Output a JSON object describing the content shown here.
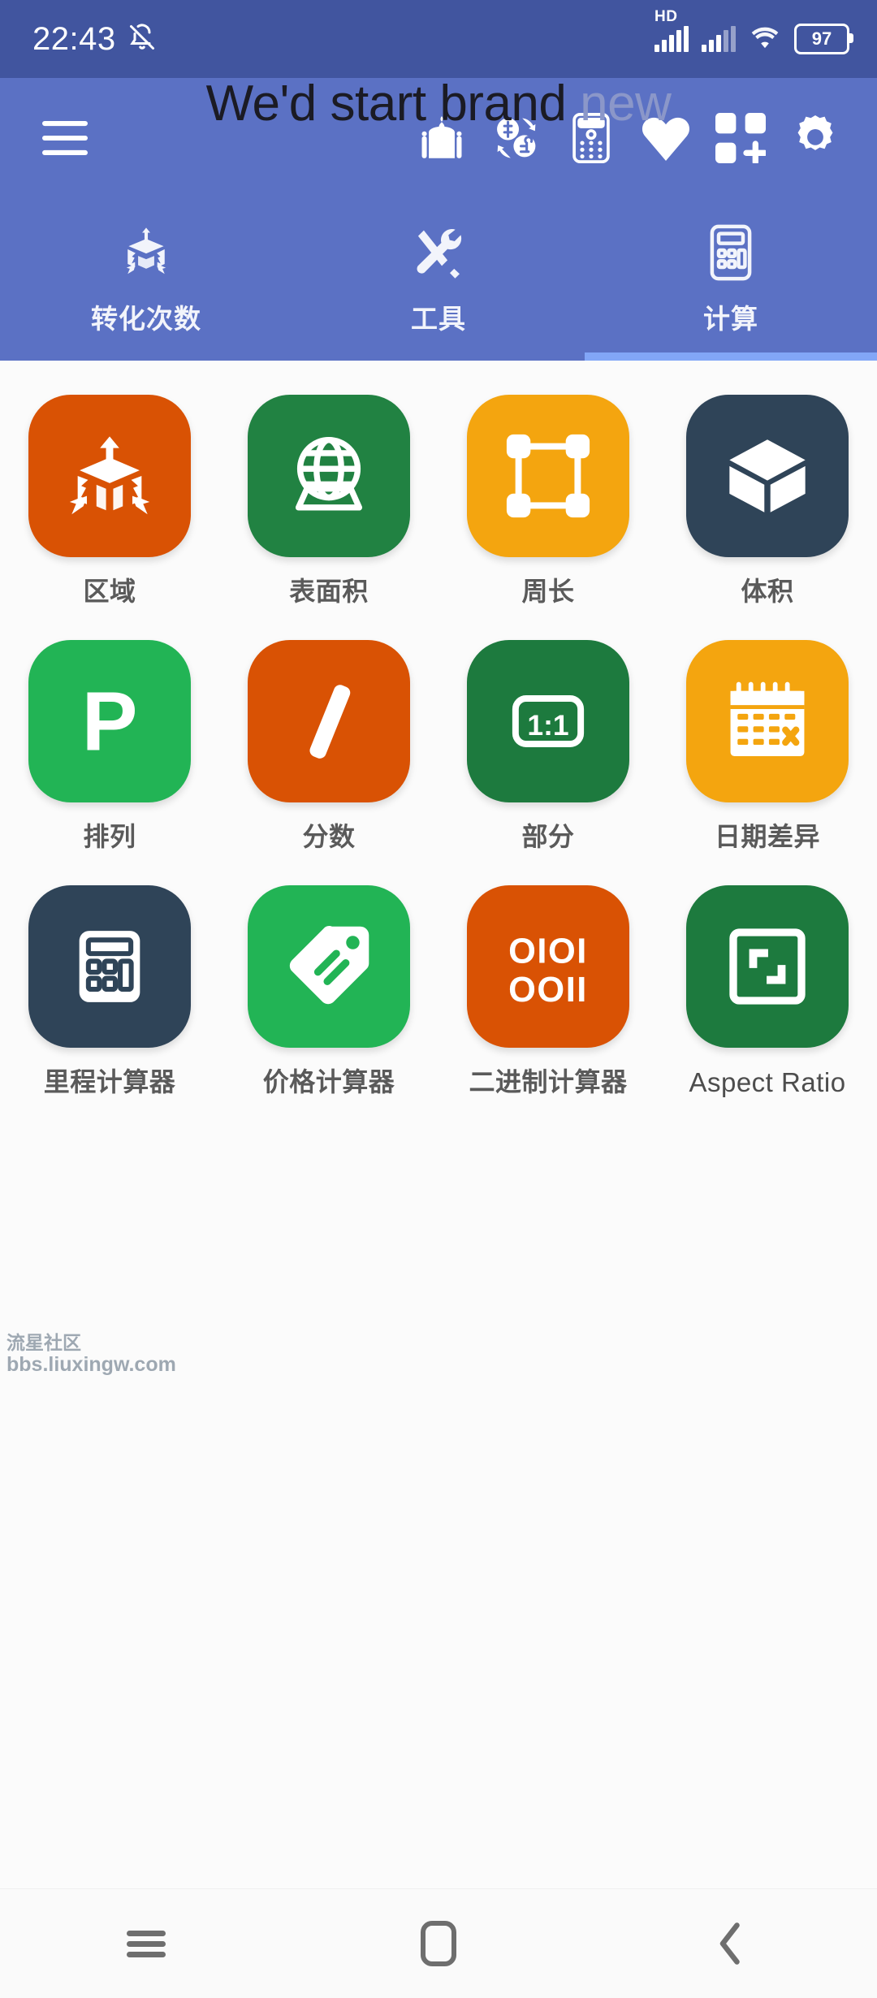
{
  "status_bar": {
    "time": "22:43",
    "notification_icon": "bell-muted-icon",
    "network_label": "HD",
    "signal_icon": "signal-bars-icon",
    "signal2_icon": "signal-bars-secondary-icon",
    "wifi_icon": "wifi-icon",
    "battery_level": "97",
    "background_color": "#41559f"
  },
  "app_bar": {
    "overlay_title_main": "We'd start brand",
    "overlay_title_faded": "new",
    "background_color": "#5b71c4",
    "icons": [
      {
        "name": "menu-icon",
        "label": "Menu"
      },
      {
        "name": "mosque-icon",
        "label": "Mosque"
      },
      {
        "name": "currency-exchange-icon",
        "label": "Currency"
      },
      {
        "name": "calculator-device-icon",
        "label": "Calculator"
      },
      {
        "name": "heart-icon",
        "label": "Favorites"
      },
      {
        "name": "add-widget-icon",
        "label": "Add widget"
      },
      {
        "name": "gear-icon",
        "label": "Settings"
      }
    ]
  },
  "tabs": [
    {
      "label": "转化次数",
      "icon": "convert-box-icon",
      "active": false
    },
    {
      "label": "工具",
      "icon": "tools-icon",
      "active": false
    },
    {
      "label": "计算",
      "icon": "calculator-icon",
      "active": true
    }
  ],
  "tab_indicator_color": "#82a6f7",
  "grid": {
    "items": [
      {
        "label": "区域",
        "icon": "area-box-arrows-icon",
        "color": "#d95204",
        "latin": false
      },
      {
        "label": "表面积",
        "icon": "surface-globe-icon",
        "color": "#218242",
        "latin": false
      },
      {
        "label": "周长",
        "icon": "perimeter-square-icon",
        "color": "#f4a50f",
        "latin": false
      },
      {
        "label": "体积",
        "icon": "volume-cube-icon",
        "color": "#2f4458",
        "latin": false
      },
      {
        "label": "排列",
        "icon": "permutation-p-icon",
        "color": "#22b455",
        "latin": false
      },
      {
        "label": "分数",
        "icon": "fraction-slash-icon",
        "color": "#d95204",
        "latin": false
      },
      {
        "label": "部分",
        "icon": "ratio-1-1-icon",
        "color": "#1d7a3e",
        "latin": false
      },
      {
        "label": "日期差异",
        "icon": "calendar-diff-icon",
        "color": "#f4a50f",
        "latin": false
      },
      {
        "label": "里程计算器",
        "icon": "mileage-calculator-icon",
        "color": "#2f4458",
        "latin": false
      },
      {
        "label": "价格计算器",
        "icon": "price-tag-icon",
        "color": "#22b455",
        "latin": false
      },
      {
        "label": "二进制计算器",
        "icon": "binary-calculator-icon",
        "color": "#d95204",
        "latin": false
      },
      {
        "label": "Aspect Ratio",
        "icon": "aspect-ratio-icon",
        "color": "#1d7a3e",
        "latin": true
      }
    ]
  },
  "watermark": {
    "line1": "流星社区",
    "line2": "bbs.liuxingw.com"
  },
  "nav_bar": {
    "recents_label": "recents-icon",
    "home_label": "home-icon",
    "back_label": "back-icon"
  }
}
